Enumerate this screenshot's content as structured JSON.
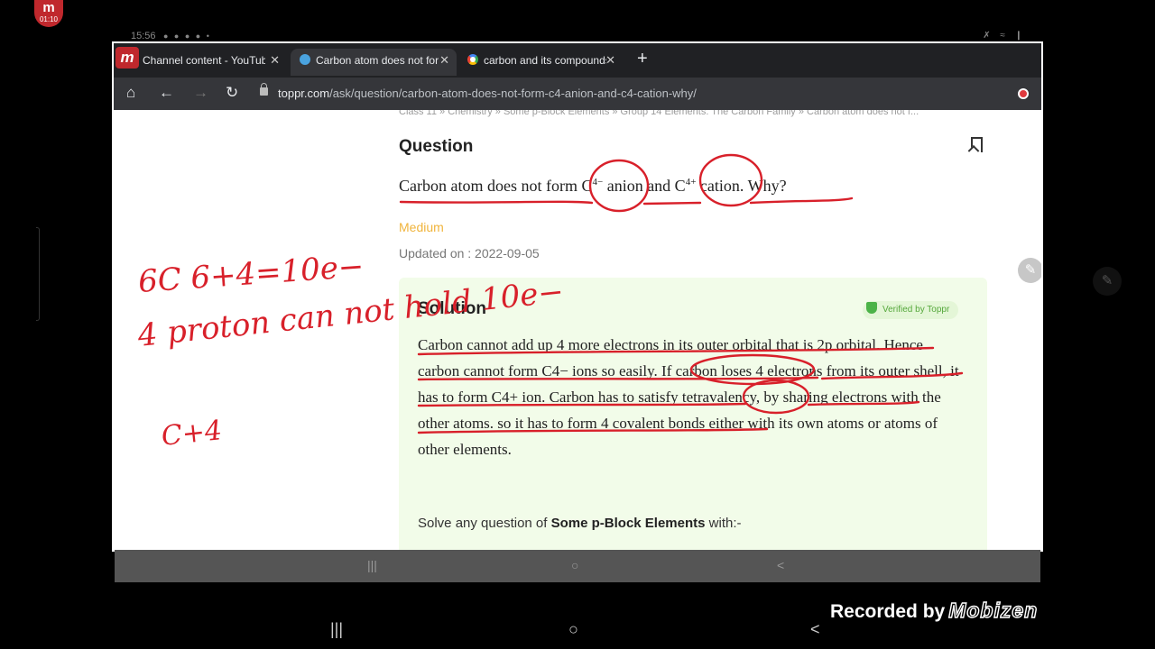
{
  "recorder": {
    "badge_logo": "m",
    "badge_time": "01:10",
    "watermark_prefix": "Recorded by",
    "watermark_brand": "Mobizen"
  },
  "status_bar": {
    "time": "15:56",
    "icons": "● ● ● ● •",
    "right_icons": "✗ ≈ ❙"
  },
  "browser": {
    "app_logo": "m",
    "tabs": [
      {
        "label": "Channel content - YouTube",
        "close": "✕"
      },
      {
        "label": "Carbon atom does not form",
        "close": "✕"
      },
      {
        "label": "carbon and its compounds",
        "close": "✕"
      }
    ],
    "new_tab": "+",
    "url_host": "toppr.com",
    "url_path": "/ask/question/carbon-atom-does-not-form-c4-anion-and-c4-cation-why/",
    "icons": {
      "home": "⌂",
      "back": "←",
      "forward": "→",
      "reload": "↻",
      "star": "☆",
      "download": "⬇"
    }
  },
  "page": {
    "breadcrumb": "Class 11 » Chemistry » Some p-Block Elements » Group 14 Elements: The Carbon Family » Carbon atom does not f...",
    "question_heading": "Question",
    "question_parts": {
      "a": "Carbon atom does not form C",
      "a_sup": "4−",
      "b": " anion and C",
      "b_sup": "4+",
      "c": " cation. Why?"
    },
    "difficulty": "Medium",
    "updated": "Updated on : 2022-09-05",
    "solution": {
      "heading": "Solution",
      "verified": "Verified by Toppr",
      "text": "Carbon cannot add up 4 more electrons in its outer orbital that is 2p orbital. Hence carbon cannot form C4− ions so easily. If carbon loses 4 electrons from its outer shell, it has to form C4+ ion. Carbon has to satisfy tetravalency, by sharing electrons with the other atoms. so it has to form 4 covalent bonds either with its own atoms or atoms of other elements.",
      "solve_prefix": "Solve any question of ",
      "solve_topic": "Some p-Block Elements",
      "solve_suffix": " with:-"
    },
    "edit_fab": "✎"
  },
  "handwriting": {
    "line1": "6C 6+4=10e−",
    "line2": "4 proton can not hold 10e−",
    "line3": "C+4"
  },
  "system_nav": {
    "recents": "|||",
    "home": "○",
    "back": "<"
  },
  "outer_edit": "✎"
}
